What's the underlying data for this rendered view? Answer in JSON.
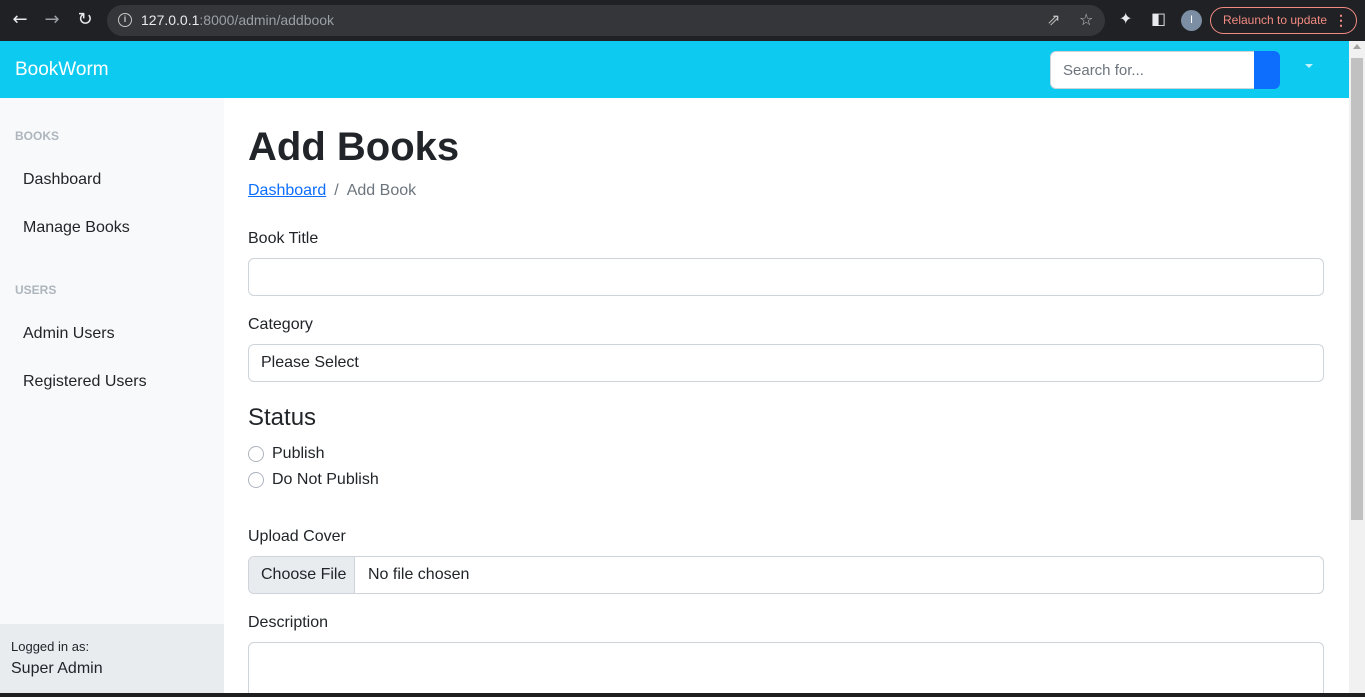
{
  "browser": {
    "url_host": "127.0.0.1",
    "url_rest": ":8000/admin/addbook",
    "profile_initial": "I",
    "relaunch_label": "Relaunch to update",
    "back_icon": "arrow-left-icon",
    "forward_icon": "arrow-right-icon",
    "reload_icon": "reload-icon"
  },
  "navbar": {
    "brand": "BookWorm",
    "search_placeholder": "Search for...",
    "bg_color": "#0dcaf0",
    "search_button_color": "#0d6efd"
  },
  "sidebar": {
    "sections": [
      {
        "heading": "Books",
        "items": [
          {
            "label": "Dashboard"
          },
          {
            "label": "Manage Books"
          }
        ]
      },
      {
        "heading": "Users",
        "items": [
          {
            "label": "Admin Users"
          },
          {
            "label": "Registered Users"
          }
        ]
      }
    ],
    "footer": {
      "caption": "Logged in as:",
      "user": "Super Admin"
    }
  },
  "main": {
    "title": "Add Books",
    "breadcrumb": {
      "link": "Dashboard",
      "separator": "/",
      "current": "Add Book"
    },
    "form": {
      "book_title_label": "Book Title",
      "book_title_value": "",
      "category_label": "Category",
      "category_selected": "Please Select",
      "status_heading": "Status",
      "status_options": [
        {
          "label": "Publish",
          "checked": false
        },
        {
          "label": "Do Not Publish",
          "checked": false
        }
      ],
      "upload_label": "Upload Cover",
      "file_button": "Choose File",
      "file_status": "No file chosen",
      "description_label": "Description",
      "description_value": ""
    }
  }
}
